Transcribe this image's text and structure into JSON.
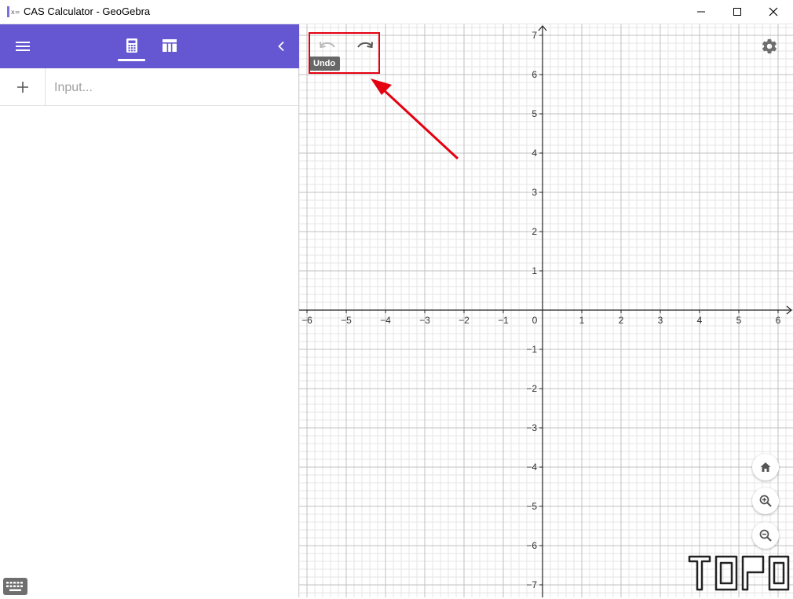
{
  "window": {
    "title": "CAS Calculator - GeoGebra",
    "controls": [
      "minimize-icon",
      "maximize-icon",
      "close-icon"
    ]
  },
  "toolbar": {
    "color": "#6557d2",
    "icons": [
      "menu-icon",
      "calculator-icon",
      "table-icon",
      "chevron-left-icon"
    ],
    "active_tab": "calculator"
  },
  "input": {
    "placeholder": "Input..."
  },
  "graph": {
    "undo_tooltip": "Undo",
    "x_ticks": [
      "−6",
      "−5",
      "−4",
      "−3",
      "−2",
      "−1",
      "0",
      "1",
      "2",
      "3",
      "4",
      "5",
      "6"
    ],
    "y_ticks": [
      "7",
      "6",
      "5",
      "4",
      "3",
      "2",
      "1",
      "−1",
      "−2",
      "−3",
      "−4",
      "−5",
      "−6",
      "−7"
    ],
    "x_range": [
      -6,
      6
    ],
    "y_range": [
      -7,
      7
    ],
    "major_grid_color": "#c0c0c0",
    "minor_grid_color": "#e6e6e6",
    "zoom_controls": [
      "home-icon",
      "zoom-in-icon",
      "zoom-out-icon"
    ]
  },
  "annotation": {
    "color": "#e40010"
  }
}
